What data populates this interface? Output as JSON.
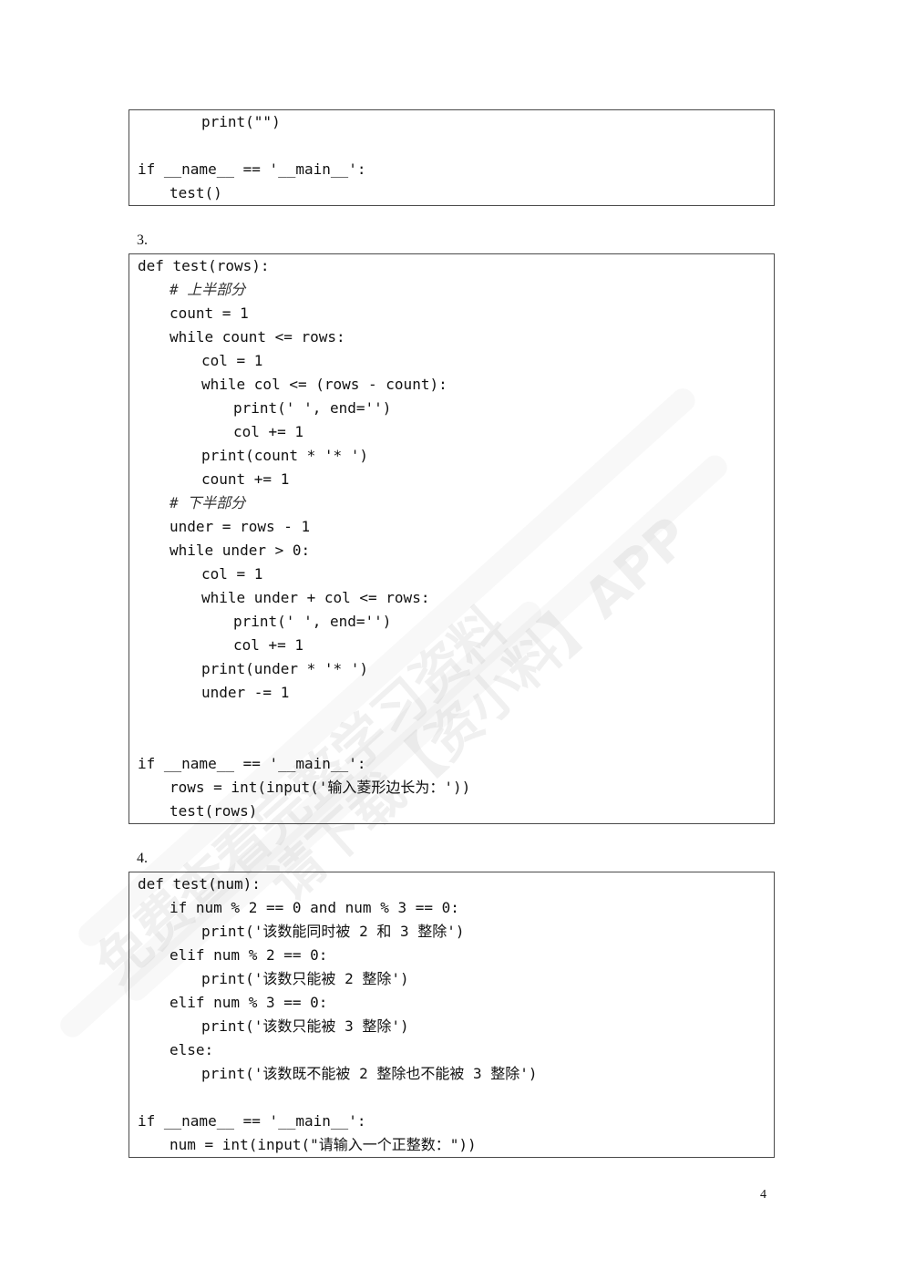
{
  "block2_tail": {
    "lines": [
      {
        "indent": 2,
        "text": "print(\"\")"
      },
      {
        "indent": 0,
        "text": ""
      },
      {
        "indent": 0,
        "text": "if __name__ == '__main__':"
      },
      {
        "indent": 1,
        "text": "test()"
      }
    ]
  },
  "section3": {
    "label": "3.",
    "lines": [
      {
        "indent": 0,
        "text": "def test(rows):"
      },
      {
        "indent": 1,
        "text": "# 上半部分",
        "comment": true
      },
      {
        "indent": 1,
        "text": "count = 1"
      },
      {
        "indent": 1,
        "text": "while count <= rows:"
      },
      {
        "indent": 2,
        "text": "col = 1"
      },
      {
        "indent": 2,
        "text": "while col <= (rows - count):"
      },
      {
        "indent": 3,
        "text": "print(' ', end='')"
      },
      {
        "indent": 3,
        "text": "col += 1"
      },
      {
        "indent": 2,
        "text": "print(count * '* ')"
      },
      {
        "indent": 2,
        "text": "count += 1"
      },
      {
        "indent": 1,
        "text": "# 下半部分",
        "comment": true
      },
      {
        "indent": 1,
        "text": "under = rows - 1"
      },
      {
        "indent": 1,
        "text": "while under > 0:"
      },
      {
        "indent": 2,
        "text": "col = 1"
      },
      {
        "indent": 2,
        "text": "while under + col <= rows:"
      },
      {
        "indent": 3,
        "text": "print(' ', end='')"
      },
      {
        "indent": 3,
        "text": "col += 1"
      },
      {
        "indent": 2,
        "text": "print(under * '* ')"
      },
      {
        "indent": 2,
        "text": "under -= 1"
      },
      {
        "indent": 0,
        "text": ""
      },
      {
        "indent": 0,
        "text": ""
      },
      {
        "indent": 0,
        "text": "if __name__ == '__main__':"
      },
      {
        "indent": 1,
        "text": "rows = int(input('输入菱形边长为：'))"
      },
      {
        "indent": 1,
        "text": "test(rows)"
      }
    ]
  },
  "section4": {
    "label": "4.",
    "lines": [
      {
        "indent": 0,
        "text": "def test(num):"
      },
      {
        "indent": 1,
        "text": "if num % 2 == 0 and num % 3 == 0:"
      },
      {
        "indent": 2,
        "text": "print('该数能同时被 2 和 3 整除')"
      },
      {
        "indent": 1,
        "text": "elif num % 2 == 0:"
      },
      {
        "indent": 2,
        "text": "print('该数只能被 2 整除')"
      },
      {
        "indent": 1,
        "text": "elif num % 3 == 0:"
      },
      {
        "indent": 2,
        "text": "print('该数只能被 3 整除')"
      },
      {
        "indent": 1,
        "text": "else:"
      },
      {
        "indent": 2,
        "text": "print('该数既不能被 2 整除也不能被 3 整除')"
      },
      {
        "indent": 0,
        "text": ""
      },
      {
        "indent": 0,
        "text": "if __name__ == '__main__':"
      },
      {
        "indent": 1,
        "text": "num = int(input(\"请输入一个正整数：\"))"
      }
    ]
  },
  "watermark": {
    "line1": "免费查看完整学习资料",
    "line2": "请下载【资小料】APP"
  },
  "page_number": "4"
}
